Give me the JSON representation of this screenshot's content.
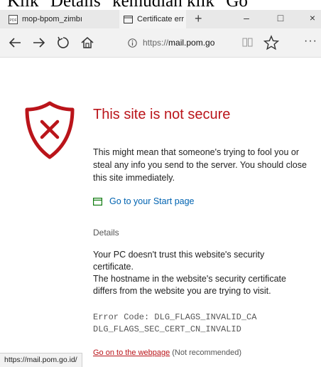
{
  "caption": "Klik \"Details\" kemudian klik \"Go",
  "tabs": [
    {
      "label": "mop-bpom_zimbı",
      "icon": "pdf-icon"
    },
    {
      "label": "Certificate err",
      "icon": "page-icon",
      "close": "×"
    }
  ],
  "new_tab": "+",
  "window_controls": {
    "minimize": "–",
    "maximize": "□",
    "close": "×"
  },
  "address_bar": {
    "protocol": "https://",
    "host": "mail.pom.go"
  },
  "more_menu": "···",
  "error": {
    "title": "This site is not secure",
    "description": "This might mean that someone's trying to fool you or steal any info you send to the server. You should close this site immediately.",
    "start_page_link": "Go to your Start page",
    "details_label": "Details",
    "trust_line1": "Your PC doesn't trust this website's security certificate.",
    "trust_line2": "The hostname in the website's security certificate differs from the website you are trying to visit.",
    "error_code_line1": "Error Code: DLG_FLAGS_INVALID_CA",
    "error_code_line2": "DLG_FLAGS_SEC_CERT_CN_INVALID",
    "go_on_link": "Go on to the webpage",
    "go_on_note": "(Not recommended)"
  },
  "status_url": "https://mail.pom.go.id/",
  "colors": {
    "accent_red": "#ba141a",
    "link_blue": "#0063b1",
    "start_green": "#107c10"
  }
}
